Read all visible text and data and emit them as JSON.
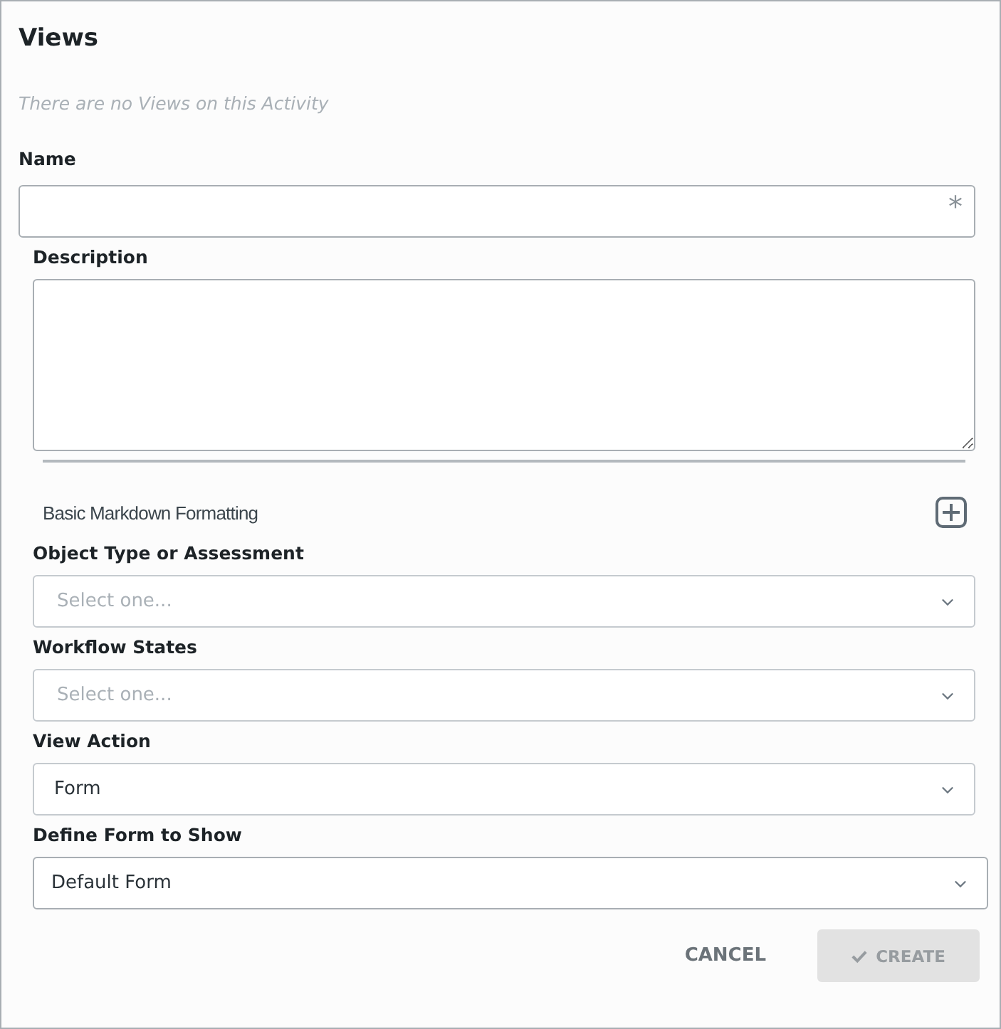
{
  "title": "Views",
  "empty_message": "There are no Views on this Activity",
  "name_field": {
    "label": "Name",
    "required_mark": "*"
  },
  "description_field": {
    "label": "Description"
  },
  "markdown_help": {
    "label": "Basic Markdown Formatting",
    "expanded": false
  },
  "selects": [
    {
      "label": "Object Type or Assessment",
      "placeholder": "Select one..."
    },
    {
      "label": "Workflow States",
      "placeholder": "Select one..."
    },
    {
      "label": "View Action",
      "value": "Form"
    },
    {
      "label": "Define Form to Show",
      "value": "Default Form"
    }
  ],
  "buttons": {
    "cancel": "CANCEL",
    "create": {
      "label": "CREATE",
      "disabled": true
    }
  }
}
